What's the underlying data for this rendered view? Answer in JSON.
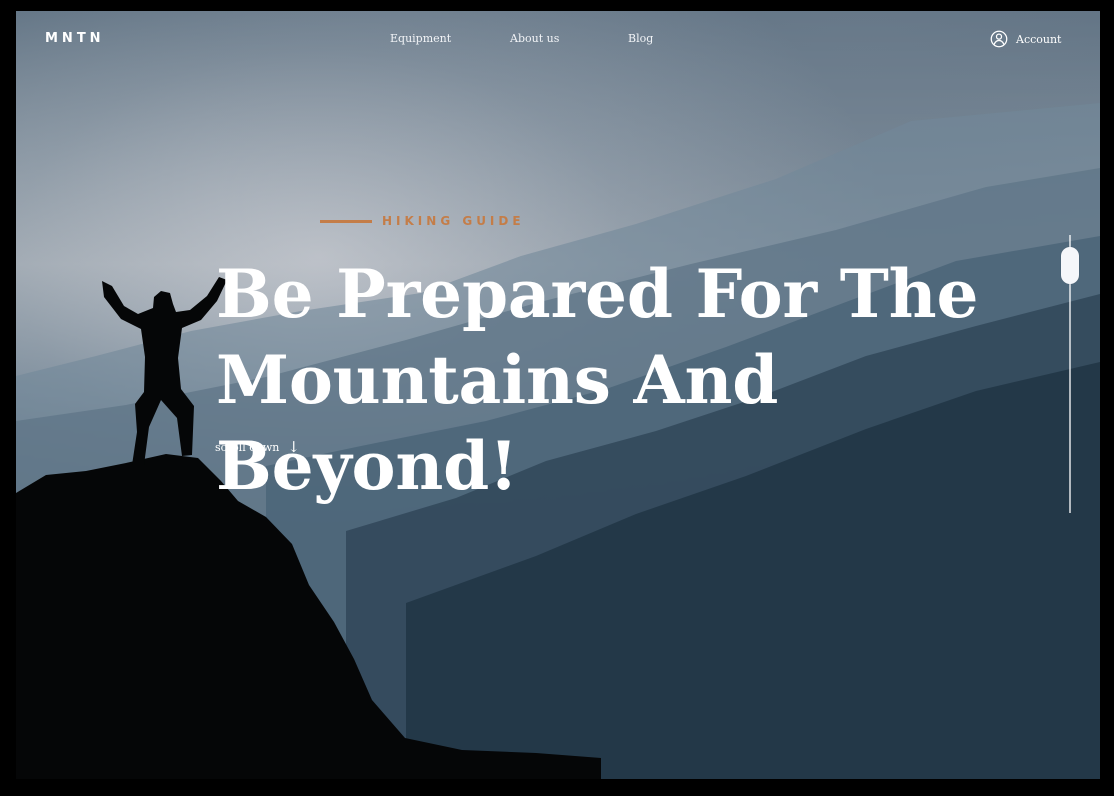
{
  "brand": {
    "logo": "MNTN"
  },
  "navigation": {
    "items": [
      {
        "label": "Equipment"
      },
      {
        "label": "About us"
      },
      {
        "label": "Blog"
      }
    ],
    "account_label": "Account"
  },
  "hero": {
    "eyebrow": "HIKING GUIDE",
    "title_line_1": "Be Prepared For The",
    "title_line_2": "Mountains And Beyond!",
    "scroll_label": "scroll down",
    "scroll_icon": "arrow-down-icon"
  },
  "colors": {
    "accent": "#c47d48",
    "text": "#ffffff"
  },
  "scrollbar": {
    "position": 0
  }
}
